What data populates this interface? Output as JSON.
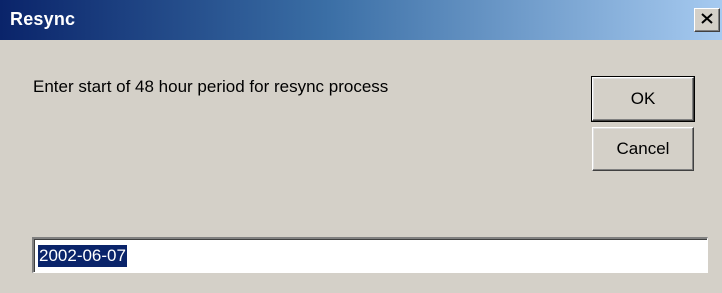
{
  "window": {
    "title": "Resync",
    "close_icon": "close-icon"
  },
  "dialog": {
    "prompt": "Enter start of 48 hour period for resync process",
    "ok_label": "OK",
    "cancel_label": "Cancel",
    "input_value": "2002-06-07",
    "input_selected": true
  },
  "colors": {
    "titlebar_start": "#0a246a",
    "titlebar_end": "#a6caf0",
    "face": "#d4d0c8",
    "selection": "#0a246a"
  }
}
